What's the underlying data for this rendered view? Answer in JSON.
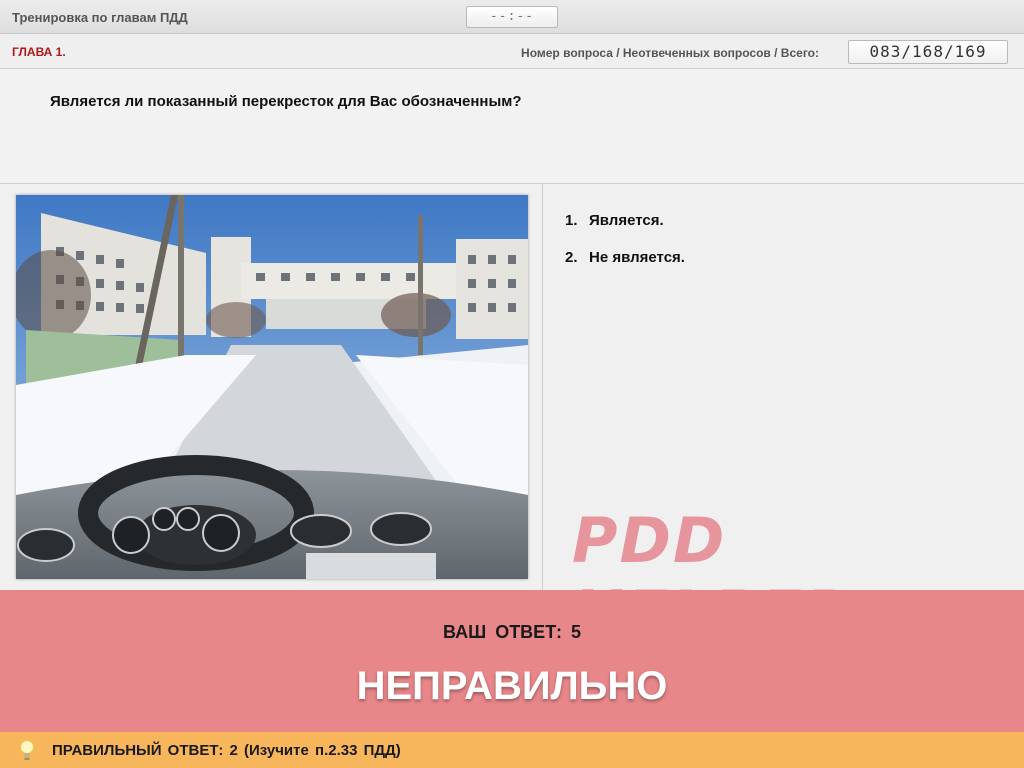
{
  "header": {
    "title": "Тренировка по главам ПДД",
    "timer": "--:--"
  },
  "chapter_bar": {
    "chapter": "ГЛАВА 1.",
    "counter_label": "Номер вопроса / Неотвеченных вопросов / Всего:",
    "counter_value": "083/168/169"
  },
  "question": {
    "text": "Является ли показанный перекресток для Вас обозначенным?"
  },
  "answers": [
    {
      "num": "1.",
      "text": "Является."
    },
    {
      "num": "2.",
      "text": "Не является."
    }
  ],
  "watermark": "PDD HELPER",
  "result": {
    "your_answer_label": "ВАШ ОТВЕТ:",
    "your_answer_value": "5",
    "verdict": "НЕПРАВИЛЬНО",
    "color": "#e8878a"
  },
  "hint": {
    "label": "ПРАВИЛЬНЫЙ ОТВЕТ:",
    "value": "2",
    "note": "(Изучите п.2.33 ПДД)",
    "color": "#f7b65c",
    "icon": "lightbulb-icon"
  }
}
